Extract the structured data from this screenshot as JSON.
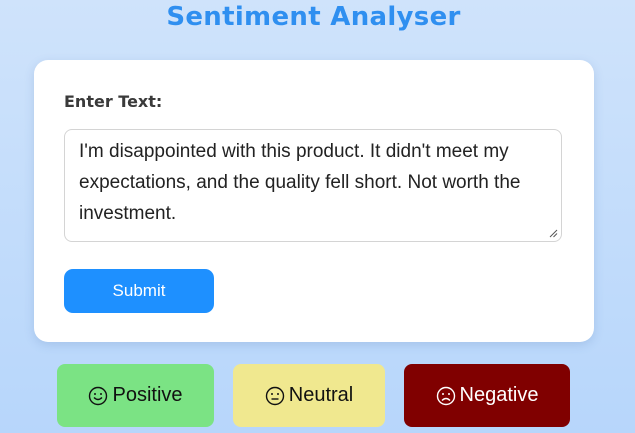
{
  "header": {
    "title": "Sentiment Analyser"
  },
  "form": {
    "label": "Enter Text:",
    "text_value": "I'm disappointed with this product. It didn't meet my expectations, and the quality fell short. Not worth the investment.",
    "submit_label": "Submit"
  },
  "sentiments": {
    "positive": {
      "label": "Positive",
      "icon": "smile-icon",
      "color": "#7be384"
    },
    "neutral": {
      "label": "Neutral",
      "icon": "neutral-face-icon",
      "color": "#f0e88f"
    },
    "negative": {
      "label": "Negative",
      "icon": "frown-icon",
      "color": "#800000"
    }
  },
  "colors": {
    "accent": "#1e90ff",
    "title": "#2f8ff0",
    "background": "#c4dcfb"
  }
}
